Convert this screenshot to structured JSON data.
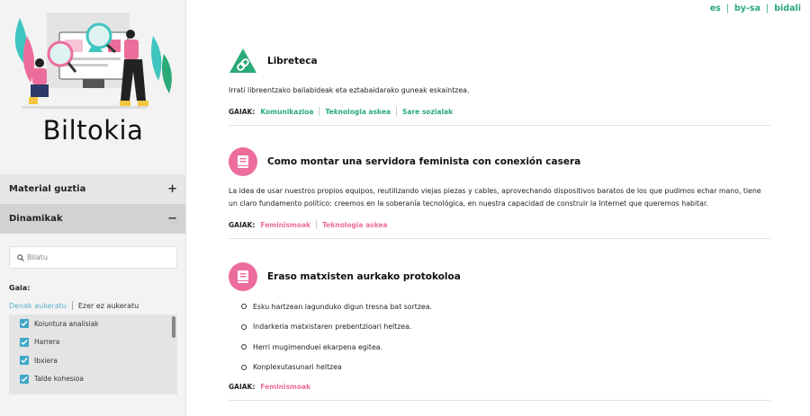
{
  "sidebar": {
    "brand": "Biltokia",
    "accordions": [
      {
        "label": "Material guztia",
        "sign": "+"
      },
      {
        "label": "Dinamikak",
        "sign": "−"
      }
    ],
    "search": {
      "placeholder": "Bilatu"
    },
    "gaia_label": "Gaia:",
    "toggle_all": "Denak aukeratu",
    "toggle_none": "Ezer ez aukeratu",
    "checklist": [
      "Koiuntura analisiak",
      "Harrera",
      "Ibxiera",
      "Talde kohesioa"
    ]
  },
  "toplinks": [
    "es",
    "by-sa",
    "bidali"
  ],
  "entries": [
    {
      "title": "Libreteca",
      "description": "Irrati libreentzako baliabideak eta eztabaidarako guneak eskaintzea.",
      "tags_label": "GAIAK:",
      "tags": [
        "Komunikazioa",
        "Teknologia askea",
        "Sare sozialak"
      ]
    },
    {
      "title": "Como montar una servidora feminista con conexión casera",
      "description": "La idea de usar nuestros propios equipos, reutilizando viejas piezas y cables, aprovechando dispositivos baratos de los que pudimos echar mano, tiene un claro fundamento político: creemos en la soberanía tecnológica, en nuestra capacidad de construir la Internet que queremos habitar.",
      "tags_label": "GAIAK:",
      "tags": [
        "Feminismoak",
        "Teknologia askea"
      ]
    },
    {
      "title": "Eraso matxisten aurkako protokoloa",
      "bullets": [
        "Esku hartzean lagunduko digun tresna bat sortzea.",
        "Indarkeria matxistaren prebentzioari heltzea.",
        "Herri mugimenduei ekarpena egitea.",
        "Konplexutasunari heltzea"
      ],
      "tags_label": "GAIAK:",
      "tags": [
        "Feminismoak"
      ]
    }
  ],
  "colors": {
    "green": "#2aaa78",
    "pink": "#ec6d9c",
    "checkbox": "#3fa7c7"
  },
  "icons": {
    "entry_1": "link-triangle-icon",
    "entry_2": "book-icon",
    "entry_3": "book-icon"
  }
}
